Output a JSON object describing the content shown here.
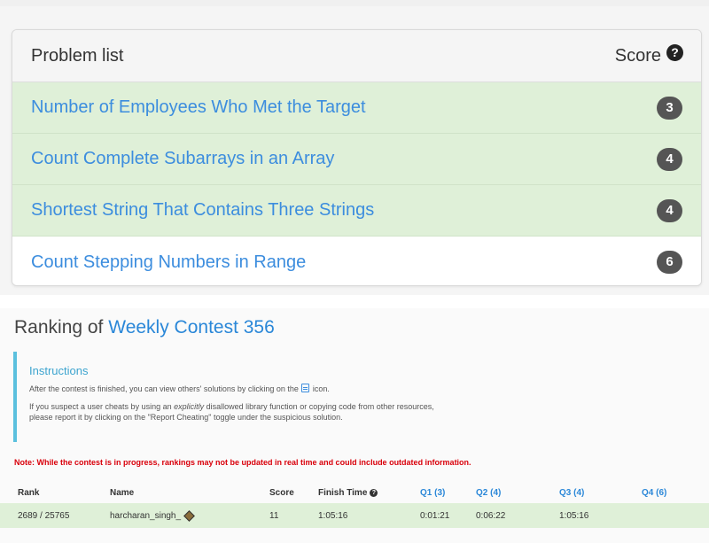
{
  "problem_list": {
    "title": "Problem list",
    "score_header": "Score",
    "help_glyph": "?",
    "problems": [
      {
        "name": "Number of Employees Who Met the Target",
        "score": "3",
        "solved": true
      },
      {
        "name": "Count Complete Subarrays in an Array",
        "score": "4",
        "solved": true
      },
      {
        "name": "Shortest String That Contains Three Strings",
        "score": "4",
        "solved": true
      },
      {
        "name": "Count Stepping Numbers in Range",
        "score": "6",
        "solved": false
      }
    ]
  },
  "ranking": {
    "title_prefix": "Ranking of",
    "contest_name": "Weekly Contest 356",
    "instructions": {
      "title": "Instructions",
      "line1_before_icon": "After the contest is finished, you can view others' solutions by clicking on the",
      "line1_after_icon": "icon.",
      "line2_before_em": "If you suspect a user cheats by using an",
      "line2_em": "explicitly",
      "line2_after_em": "disallowed library function or copying code from other resources,",
      "line3": "please report it by clicking on the \"Report Cheating\" toggle under the suspicious solution."
    },
    "note": "Note: While the contest is in progress, rankings may not be updated in real time and could include outdated information.",
    "table": {
      "headers": {
        "rank": "Rank",
        "name": "Name",
        "score": "Score",
        "finish_time": "Finish Time",
        "q1": "Q1 (3)",
        "q2": "Q2 (4)",
        "q3": "Q3 (4)",
        "q4": "Q4 (6)"
      },
      "row": {
        "rank": "2689 / 25765",
        "name": "harcharan_singh_",
        "score": "11",
        "finish_time": "1:05:16",
        "q1": "0:01:21",
        "q2": "0:06:22",
        "q3": "1:05:16",
        "q4": ""
      }
    }
  },
  "icons": {
    "help": "question-circle-icon",
    "solution": "document-icon",
    "user_badge": "badge-icon"
  },
  "colors": {
    "link": "#3c8dde",
    "solved_row": "#dff0d8",
    "badge": "#555555",
    "note": "#d9000b",
    "instructions_accent": "#5bc0de"
  }
}
